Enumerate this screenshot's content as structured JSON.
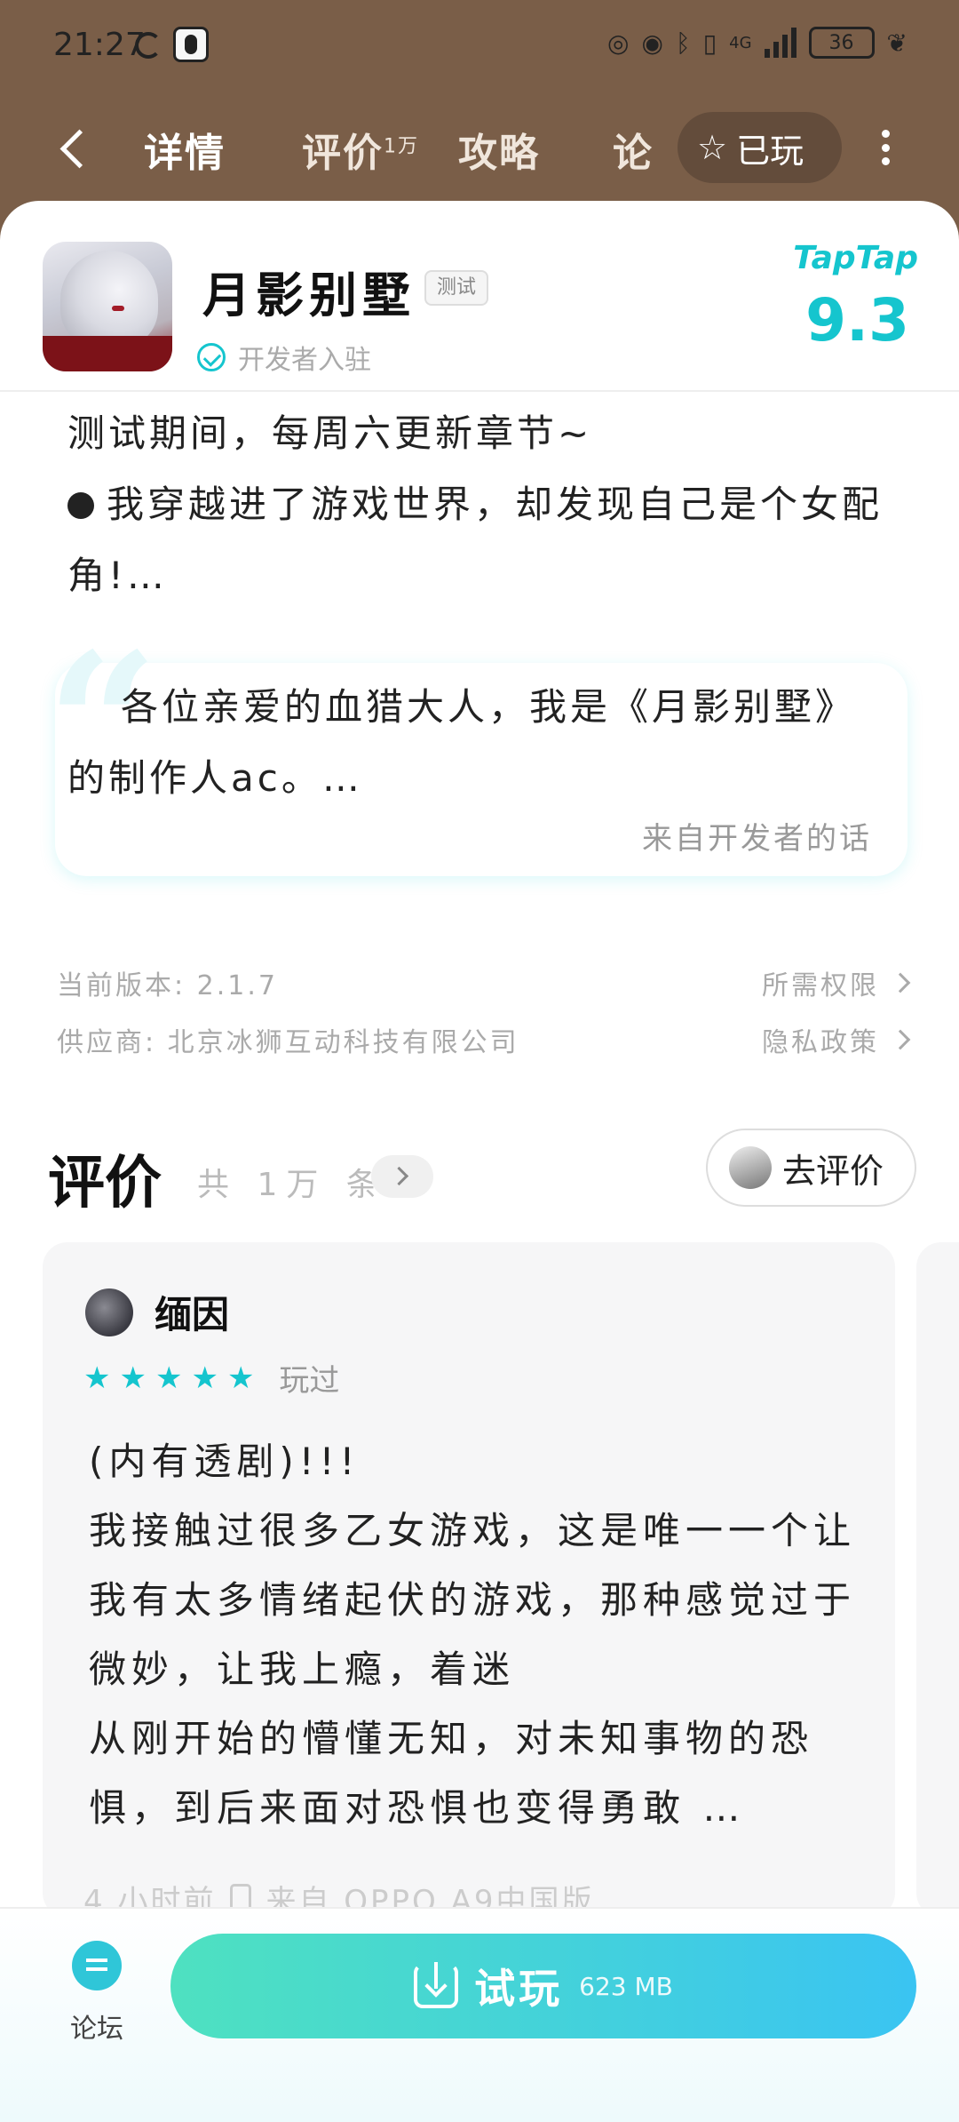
{
  "status_bar": {
    "time": "21:27",
    "network": "4G",
    "battery": "36"
  },
  "nav": {
    "tabs": [
      {
        "label": "详情",
        "active": true
      },
      {
        "label": "评价",
        "badge": "1万"
      },
      {
        "label": "攻略"
      },
      {
        "label": "论"
      }
    ],
    "played_label": "已玩"
  },
  "app": {
    "title": "月影别墅",
    "tag": "测试",
    "verified_label": "开发者入驻",
    "rating_brand": "TapTap",
    "rating": "9.3"
  },
  "description": {
    "line1": "测试期间，每周六更新章节~",
    "line2": "我穿越进了游戏世界，却发现自己是个女配角!…"
  },
  "dev_note": {
    "text": "各位亲爱的血猎大人，我是《月影别墅》的制作人ac。…",
    "source": "来自开发者的话"
  },
  "meta": {
    "version": "当前版本: 2.1.7",
    "vendor": "供应商: 北京冰狮互动科技有限公司",
    "permissions": "所需权限",
    "privacy": "隐私政策"
  },
  "reviews": {
    "title": "评价",
    "count": "共 1万 条",
    "go_review": "去评价",
    "items": [
      {
        "author": "缅因",
        "stars": 5,
        "played": "玩过",
        "body": [
          "(内有透剧)!!!",
          "我接触过很多乙女游戏，这是唯一一个让我有太多情绪起伏的游戏，那种感觉过于微妙，让我上瘾，着迷",
          "从刚开始的懵懂无知，对未知事物的恐惧，到后来面对恐惧也变得勇敢 …"
        ],
        "time": "4 小时前",
        "device": "来自 OPPO A9中国版"
      }
    ]
  },
  "bottom": {
    "forum_label": "论坛",
    "play_label": "试玩",
    "size": "623 MB"
  },
  "colors": {
    "accent": "#15c5ce",
    "header_bg": "#7a5e48"
  }
}
